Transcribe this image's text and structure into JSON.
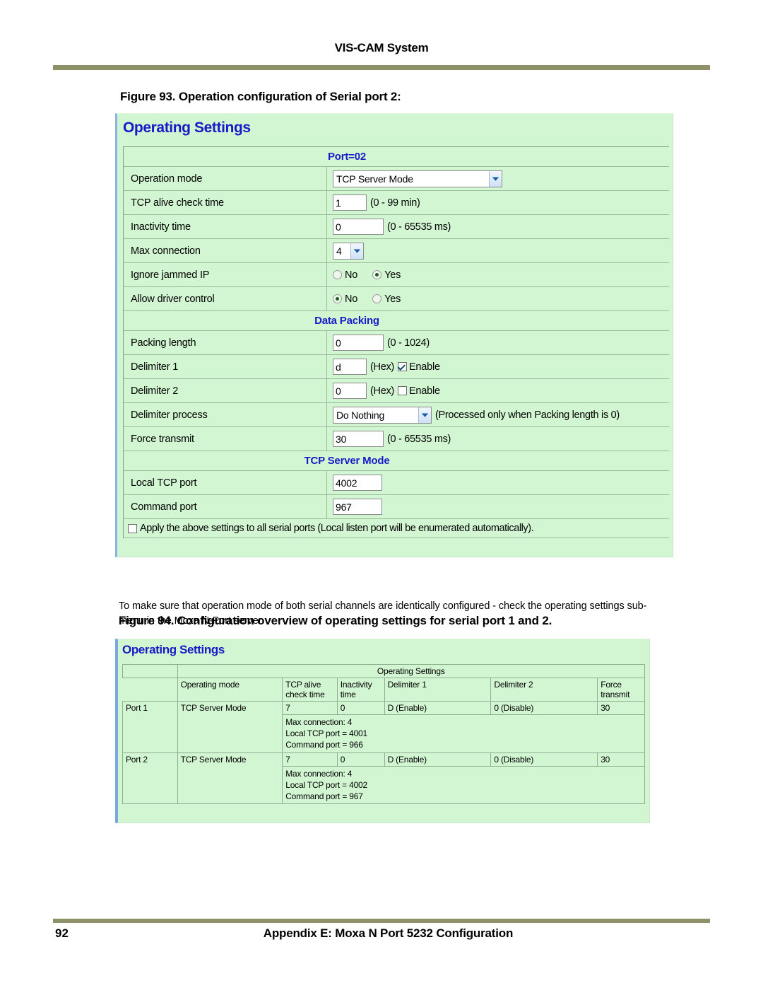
{
  "header": {
    "title": "VIS-CAM System"
  },
  "figure93": {
    "caption": "Figure 93.  Operation configuration of Serial port 2:",
    "panel_title": "Operating Settings",
    "port_header": "Port=02",
    "rows": [
      {
        "label": "Operation mode",
        "value": "TCP Server Mode"
      },
      {
        "label": "TCP alive check time",
        "value": "1",
        "hint": "(0 - 99 min)"
      },
      {
        "label": "Inactivity time",
        "value": "0",
        "hint": "(0 - 65535 ms)"
      },
      {
        "label": "Max connection",
        "value": "4"
      },
      {
        "label": "Ignore jammed IP",
        "no_label": "No",
        "yes_label": "Yes",
        "selected": "Yes"
      },
      {
        "label": "Allow driver control",
        "no_label": "No",
        "yes_label": "Yes",
        "selected": "No"
      }
    ],
    "data_packing": {
      "section_label": "Data Packing",
      "packing_length": {
        "label": "Packing length",
        "value": "0",
        "hint": "(0 - 1024)"
      },
      "delimiter1": {
        "label": "Delimiter 1",
        "value": "d",
        "hex_label": "(Hex)",
        "enable_label": "Enable",
        "enabled": true
      },
      "delimiter2": {
        "label": "Delimiter 2",
        "value": "0",
        "hex_label": "(Hex)",
        "enable_label": "Enable",
        "enabled": false
      },
      "delimiter_process": {
        "label": "Delimiter process",
        "value": "Do Nothing",
        "hint": "(Processed only when Packing length is 0)"
      },
      "force_transmit": {
        "label": "Force transmit",
        "value": "30",
        "hint": "(0 - 65535 ms)"
      }
    },
    "tcp_server_mode": {
      "section_label": "TCP Server Mode",
      "local_tcp_port": {
        "label": "Local TCP port",
        "value": "4002"
      },
      "command_port": {
        "label": "Command port",
        "value": "967"
      }
    },
    "apply_all": {
      "label": "Apply the above settings to all serial ports (Local listen port will be enumerated automatically).",
      "checked": false
    }
  },
  "body_paragraph": "To make sure that operation mode of both serial channels are identically configured - check the operating settings sub-menu in the Moxa N-Port server.",
  "figure94": {
    "caption": "Figure 94.  Configuration overview of operating settings for serial port 1 and 2.",
    "panel_title": "Operating Settings",
    "group_header": "Operating Settings",
    "columns": [
      "Operating mode",
      "TCP alive check time",
      "Inactivity time",
      "Delimiter 1",
      "Delimiter 2",
      "Force transmit"
    ],
    "ports": [
      {
        "port": "Port 1",
        "mode": "TCP Server Mode",
        "alive_check": "7",
        "inactivity": "0",
        "delimiter1": "D (Enable)",
        "delimiter2": "0 (Disable)",
        "force_transmit": "30",
        "details": [
          "Max connection: 4",
          "Local TCP port = 4001",
          "Command port = 966"
        ]
      },
      {
        "port": "Port 2",
        "mode": "TCP Server Mode",
        "alive_check": "7",
        "inactivity": "0",
        "delimiter1": "D (Enable)",
        "delimiter2": "0 (Disable)",
        "force_transmit": "30",
        "details": [
          "Max connection: 4",
          "Local TCP port = 4002",
          "Command port = 967"
        ]
      }
    ]
  },
  "footer": {
    "page_number": "92",
    "title": "Appendix E: Moxa N Port 5232 Configuration"
  },
  "colors": {
    "rule": "#8f9268",
    "panel_bg": "#d2f5d2",
    "heading_blue": "#1a1ac8",
    "border_green": "#9ab89a"
  }
}
